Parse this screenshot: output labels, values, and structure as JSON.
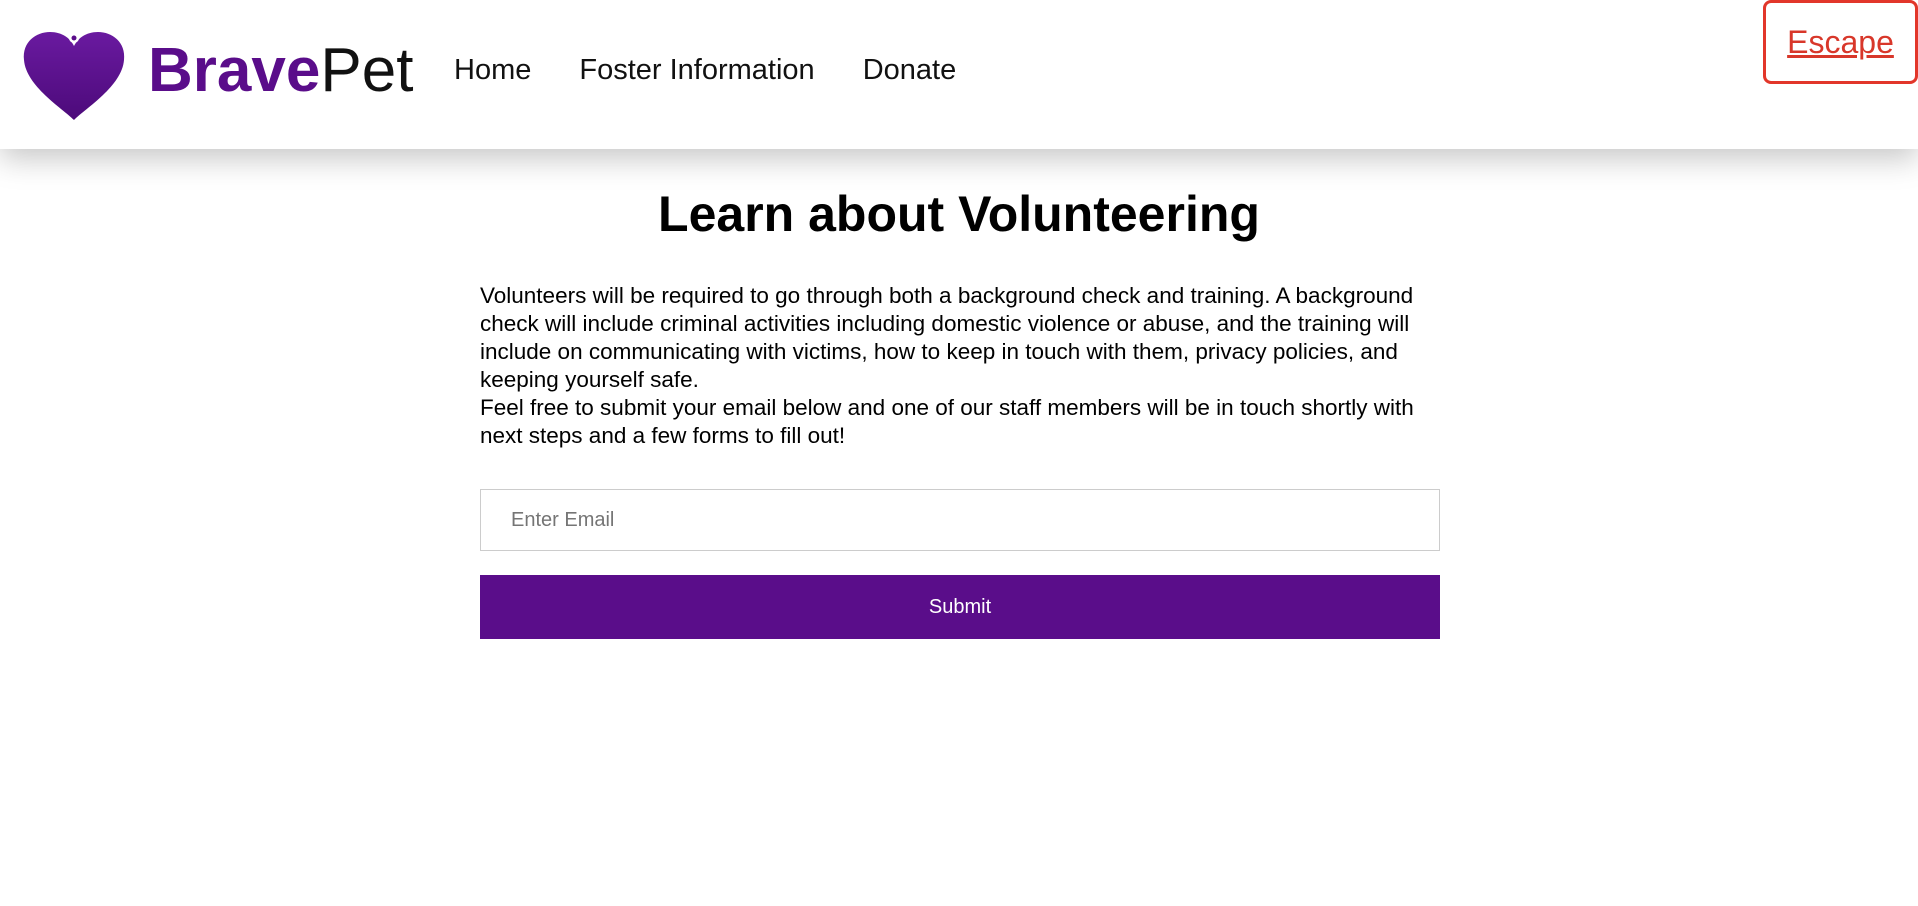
{
  "brand": {
    "name_part1": "Brave",
    "name_part2": "Pet",
    "logo_icon": "heart-tag-icon",
    "primary_color": "#5a0d8a"
  },
  "nav": {
    "items": [
      {
        "label": "Home"
      },
      {
        "label": "Foster Information"
      },
      {
        "label": "Donate"
      }
    ]
  },
  "escape": {
    "label": "Escape",
    "color": "#d8372a"
  },
  "main": {
    "title": "Learn about Volunteering",
    "paragraph1": "Volunteers will be required to go through both a background check and training. A background check will include criminal activities including domestic violence or abuse, and the training will include on communicating with victims, how to keep in touch with them, privacy policies, and keeping yourself safe.",
    "paragraph2": "Feel free to submit your email below and one of our staff members will be in touch shortly with next steps and a few forms to fill out!",
    "email_placeholder": "Enter Email",
    "email_value": "",
    "submit_label": "Submit"
  }
}
